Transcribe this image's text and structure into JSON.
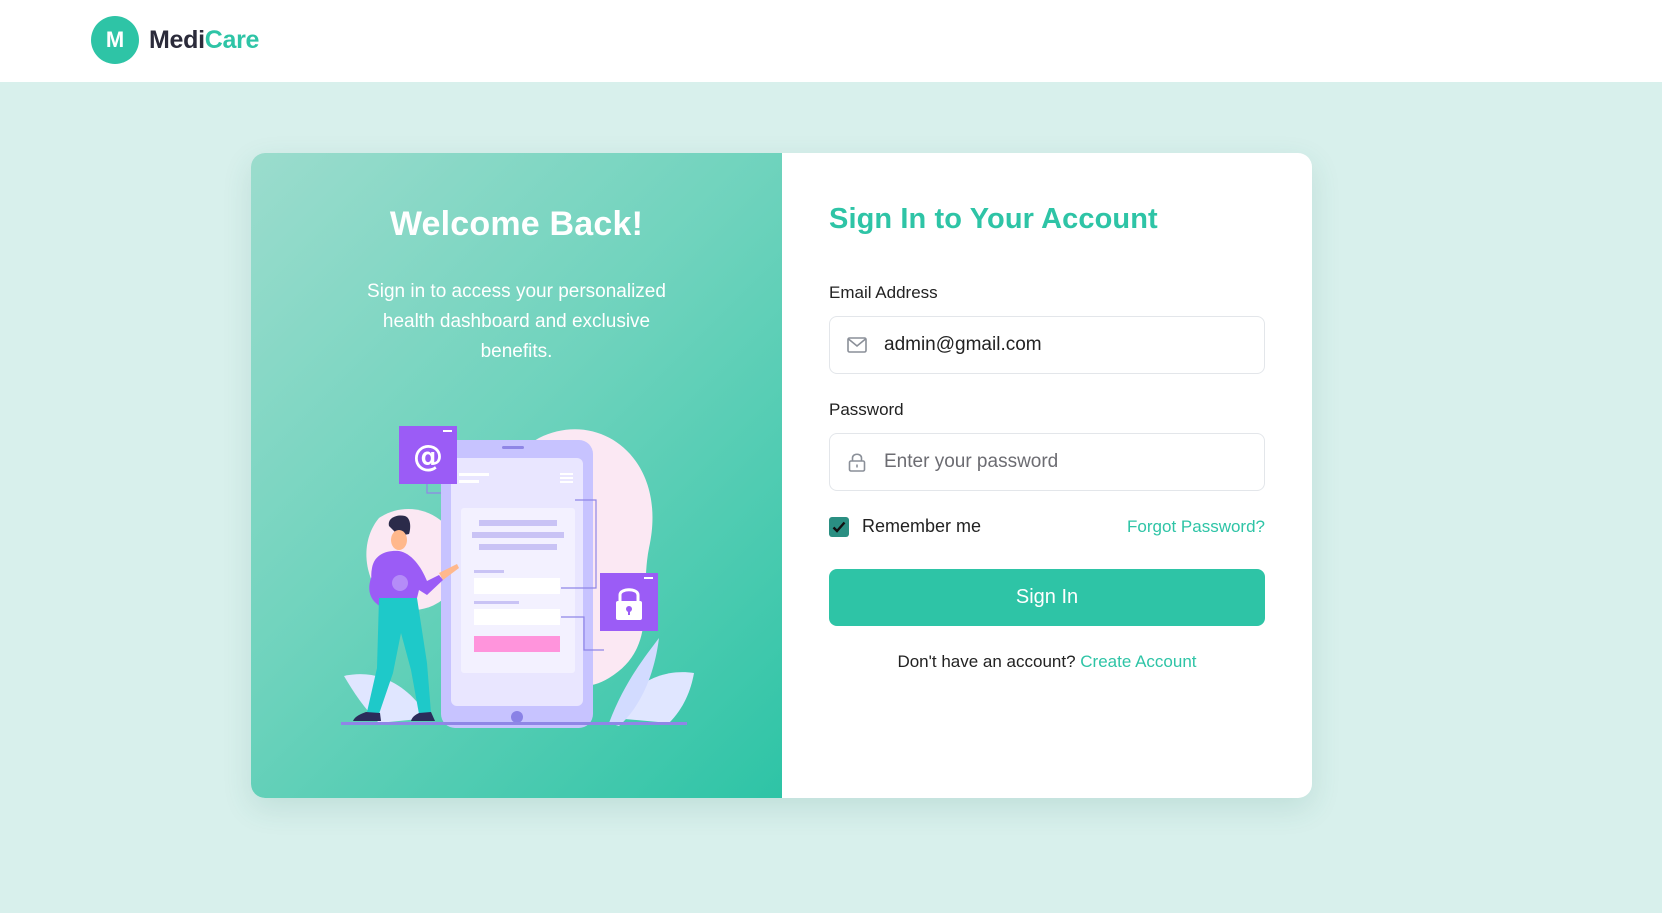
{
  "header": {
    "logo_letter": "M",
    "brand_part1": "Medi",
    "brand_part2": "Care"
  },
  "left_panel": {
    "title": "Welcome Back!",
    "subtitle": "Sign in to access your personalized health dashboard and exclusive benefits."
  },
  "form": {
    "title": "Sign In to Your Account",
    "email_label": "Email Address",
    "email_value": "admin@gmail.com",
    "password_label": "Password",
    "password_placeholder": "Enter your password",
    "remember_label": "Remember me",
    "remember_checked": true,
    "forgot_label": "Forgot Password?",
    "submit_label": "Sign In",
    "signup_prompt": "Don't have an account?",
    "signup_link": "Create Account"
  },
  "icons": {
    "email": "mail-icon",
    "password": "lock-icon",
    "check": "check-icon"
  },
  "colors": {
    "accent": "#2ec4a6",
    "page_background": "#d8f0ec",
    "checkbox": "#2a8f82"
  }
}
